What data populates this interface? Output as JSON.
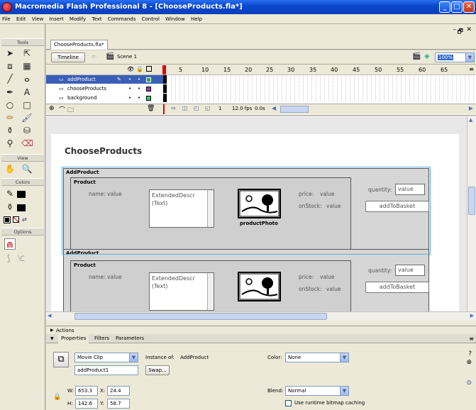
{
  "window": {
    "title": "Macromedia Flash Professional 8 - [ChooseProducts.fla*]"
  },
  "menu": [
    "File",
    "Edit",
    "View",
    "Insert",
    "Modify",
    "Text",
    "Commands",
    "Control",
    "Window",
    "Help"
  ],
  "tools": {
    "header": "Tools",
    "view_header": "View",
    "colors_header": "Colors",
    "options_header": "Options"
  },
  "document": {
    "tab": "ChooseProducts.fla*",
    "timeline_button": "Timeline",
    "scene": "Scene 1",
    "zoom": "100%"
  },
  "timeline": {
    "frame_numbers": [
      "5",
      "10",
      "15",
      "20",
      "25",
      "30",
      "35",
      "40",
      "45",
      "50",
      "55",
      "60",
      "65"
    ],
    "layers": [
      {
        "name": "addProduct",
        "selected": true
      },
      {
        "name": "chooseProducts",
        "selected": false
      },
      {
        "name": "background",
        "selected": false
      }
    ],
    "current_frame": "1",
    "fps": "12.0 fps",
    "time": "0.0s"
  },
  "stage": {
    "title": "ChooseProducts",
    "items": [
      {
        "component": "AddProduct",
        "product_label": "Product",
        "name_label": "name: value",
        "description": "ExtendedDescr (Text)",
        "photo_caption": "productPhoto",
        "price_label": "price:",
        "price_value": "value",
        "stock_label": "onStock:",
        "stock_value": "value",
        "quantity_label": "quantity:",
        "quantity_value": "value",
        "button": "addToBasket"
      },
      {
        "component": "AddProduct",
        "product_label": "Product",
        "name_label": "name: value",
        "description": "ExtendedDescr (Text)",
        "photo_caption": "",
        "price_label": "price:",
        "price_value": "value",
        "stock_label": "onStock:",
        "stock_value": "value",
        "quantity_label": "quantity:",
        "quantity_value": "value",
        "button": "addToBasket"
      }
    ]
  },
  "panels": {
    "actions": "Actions",
    "tabs": [
      "Properties",
      "Filters",
      "Parameters"
    ],
    "symbol_type": "Movie Clip",
    "instance_of_label": "Instance of:",
    "instance_of_value": "AddProduct",
    "instance_name": "addProduct1",
    "swap_button": "Swap...",
    "color_label": "Color:",
    "color_value": "None",
    "w_label": "W:",
    "w_value": "653.3",
    "x_label": "X:",
    "x_value": "24.4",
    "h_label": "H:",
    "h_value": "142.6",
    "y_label": "Y:",
    "y_value": "58.7",
    "blend_label": "Blend:",
    "blend_value": "Normal",
    "cache_label": "Use runtime bitmap caching"
  }
}
